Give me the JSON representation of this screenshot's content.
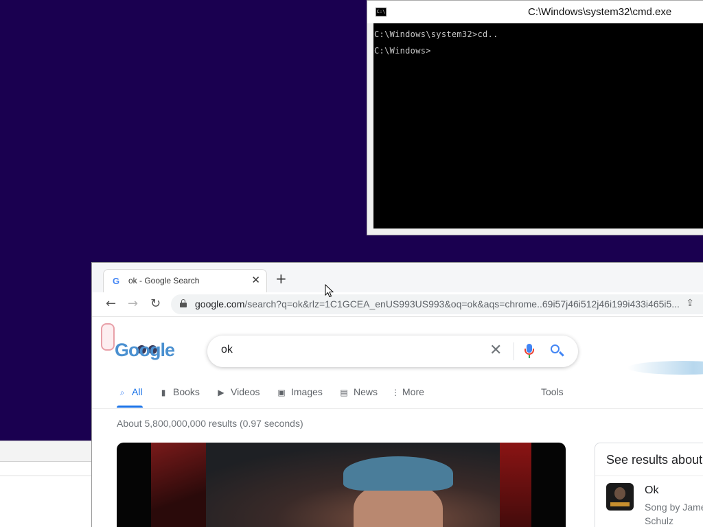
{
  "desktop": {
    "background_color": "#1a0050"
  },
  "cmd_window": {
    "title": "C:\\Windows\\system32\\cmd.exe",
    "icon_text": "C:\\",
    "lines": [
      "C:\\Windows\\system32>cd..",
      "C:\\Windows>"
    ]
  },
  "browser": {
    "tab": {
      "title": "ok - Google Search",
      "favicon": "G",
      "close_glyph": "✕"
    },
    "new_tab_glyph": "+",
    "nav": {
      "back": "←",
      "forward": "→",
      "reload": "↻"
    },
    "address": {
      "domain": "google.com",
      "rest": "/search?q=ok&rlz=1C1GCEA_enUS993US993&oq=ok&aqs=chrome..69i57j46i512j46i199i433i465i5..."
    },
    "share_glyph": "⇪"
  },
  "google": {
    "logo_text": "Google",
    "search_query": "ok",
    "clear_glyph": "✕",
    "tabs": [
      {
        "label": "All",
        "icon": "search-icon",
        "glyph": "🔍",
        "active": true
      },
      {
        "label": "Books",
        "icon": "book-icon",
        "glyph": "▮"
      },
      {
        "label": "Videos",
        "icon": "play-icon",
        "glyph": "▶"
      },
      {
        "label": "Images",
        "icon": "image-icon",
        "glyph": "▣"
      },
      {
        "label": "News",
        "icon": "news-icon",
        "glyph": "▤"
      },
      {
        "label": "More",
        "icon": "more-vert-icon",
        "glyph": "⋮"
      }
    ],
    "tools_label": "Tools",
    "result_stats": "About 5,800,000,000 results (0.97 seconds)",
    "knowledge_panel": {
      "title": "See results about",
      "item_name": "Ok",
      "item_sub": "Song by James Schulz"
    },
    "accent_color": "#1a73e8"
  }
}
